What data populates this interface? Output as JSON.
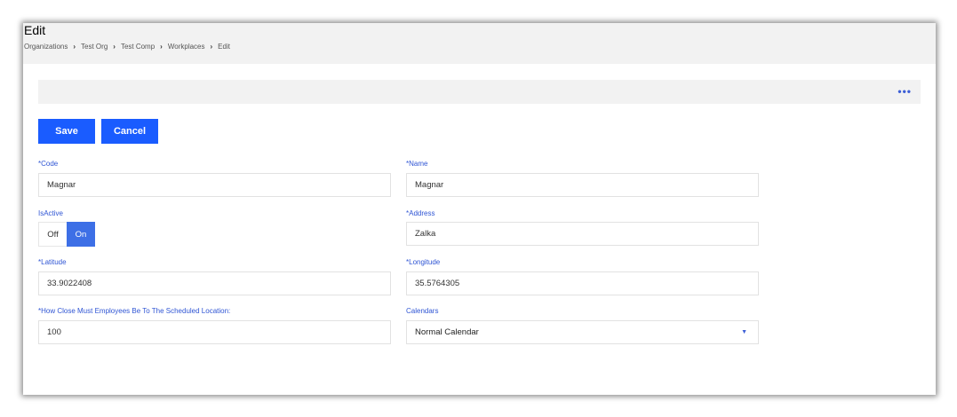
{
  "header": {
    "title": "Edit",
    "breadcrumb": [
      "Organizations",
      "Test Org",
      "Test Comp",
      "Workplaces",
      "Edit"
    ]
  },
  "toolbar": {
    "more_icon": "more-horizontal-icon",
    "save_label": "Save",
    "cancel_label": "Cancel"
  },
  "form": {
    "code": {
      "label": "*Code",
      "value": "Magnar"
    },
    "name": {
      "label": "*Name",
      "value": "Magnar"
    },
    "is_active": {
      "label": "IsActive",
      "off_label": "Off",
      "on_label": "On",
      "selected": "On"
    },
    "address": {
      "label": "*Address",
      "value": "Zalka"
    },
    "latitude": {
      "label": "*Latitude",
      "value": "33.9022408"
    },
    "longitude": {
      "label": "*Longitude",
      "value": "35.5764305"
    },
    "proximity": {
      "label": "*How Close Must Employees Be To The Scheduled Location:",
      "value": "100"
    },
    "calendars": {
      "label": "Calendars",
      "value": "Normal Calendar"
    }
  },
  "colors": {
    "accent": "#1a5cff",
    "label": "#2f55d4",
    "toggle_on": "#3d6fe6"
  }
}
